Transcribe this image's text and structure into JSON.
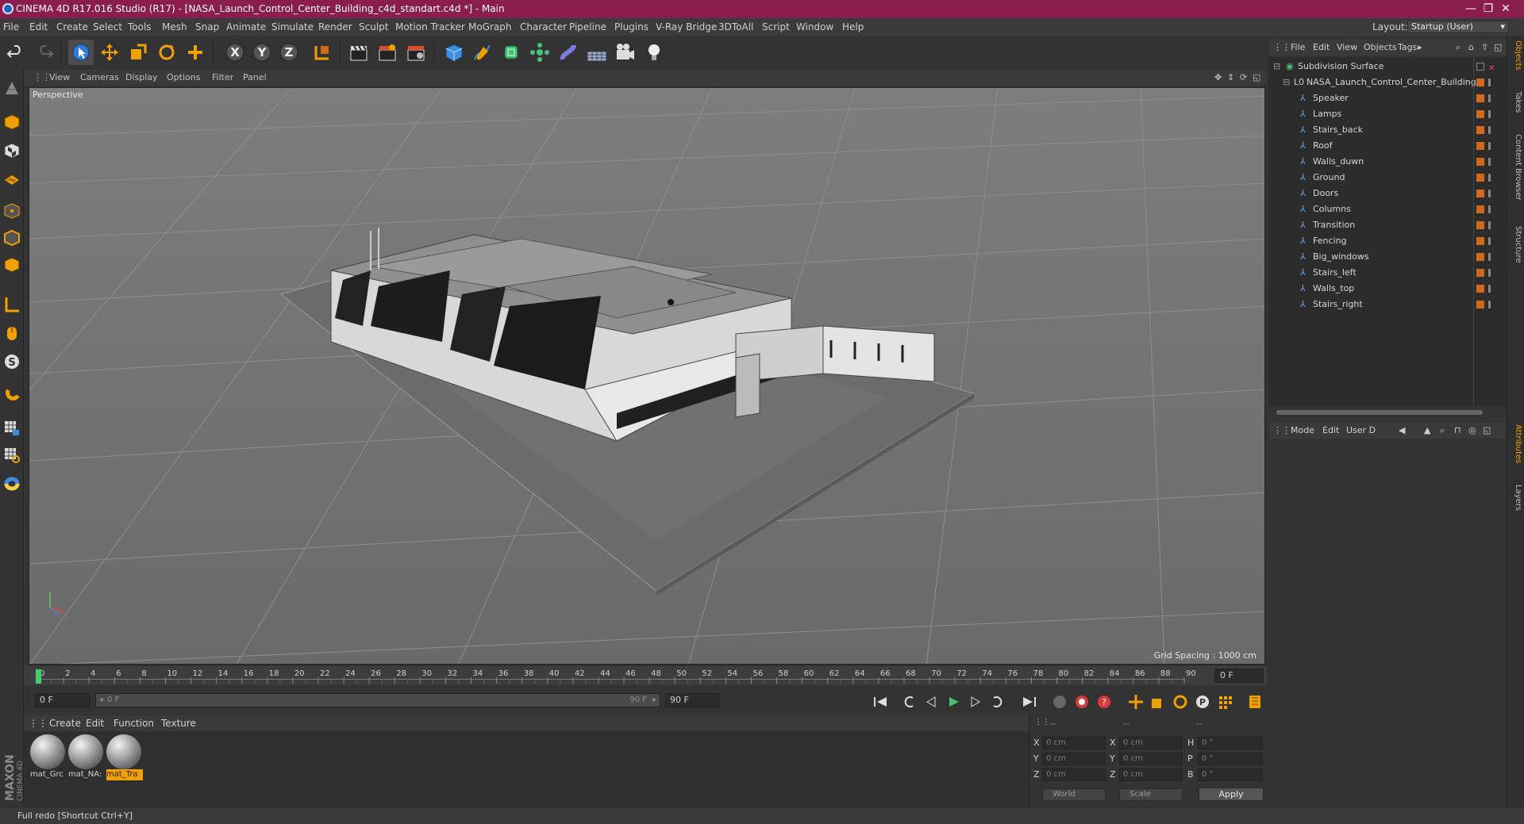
{
  "window": {
    "title": "CINEMA 4D R17.016 Studio (R17) - [NASA_Launch_Control_Center_Building_c4d_standart.c4d *] - Main",
    "minimize": "—",
    "restore": "❐",
    "close": "✕"
  },
  "menu": {
    "items": [
      "File",
      "Edit",
      "Create",
      "Select",
      "Tools",
      "Mesh",
      "Snap",
      "Animate",
      "Simulate",
      "Render",
      "Sculpt",
      "Motion Tracker",
      "MoGraph",
      "Character",
      "Pipeline",
      "Plugins",
      "V-Ray Bridge",
      "3DToAll",
      "Script",
      "Window",
      "Help"
    ],
    "layout_label": "Layout:",
    "layout_value": "Startup (User)"
  },
  "viewport": {
    "menu": [
      "View",
      "Cameras",
      "Display",
      "Options",
      "Filter",
      "Panel"
    ],
    "label": "Perspective",
    "grid_spacing": "Grid Spacing : 1000 cm"
  },
  "timeline": {
    "ticks": [
      "0",
      "2",
      "4",
      "6",
      "8",
      "10",
      "12",
      "14",
      "16",
      "18",
      "20",
      "22",
      "24",
      "26",
      "28",
      "30",
      "32",
      "34",
      "36",
      "38",
      "40",
      "42",
      "44",
      "46",
      "48",
      "50",
      "52",
      "54",
      "56",
      "58",
      "60",
      "62",
      "64",
      "66",
      "68",
      "70",
      "72",
      "74",
      "76",
      "78",
      "80",
      "82",
      "84",
      "86",
      "88",
      "90"
    ],
    "current_frame": "0 F",
    "start_field": "0 F",
    "range_start": "0 F",
    "range_end": "90 F",
    "end_field": "90 F",
    "playhead": 0
  },
  "materials": {
    "menu": [
      "Create",
      "Edit",
      "Function",
      "Texture"
    ],
    "items": [
      {
        "name": "mat_Grc",
        "selected": false
      },
      {
        "name": "mat_NA:",
        "selected": false
      },
      {
        "name": "mat_Tra",
        "selected": true
      }
    ]
  },
  "coordinates": {
    "headers": [
      "--",
      "--",
      "--"
    ],
    "rows": [
      {
        "a": "X",
        "av": "0 cm",
        "b": "X",
        "bv": "0 cm",
        "c": "H",
        "cv": "0 °"
      },
      {
        "a": "Y",
        "av": "0 cm",
        "b": "Y",
        "bv": "0 cm",
        "c": "P",
        "cv": "0 °"
      },
      {
        "a": "Z",
        "av": "0 cm",
        "b": "Z",
        "bv": "0 cm",
        "c": "B",
        "cv": "0 °"
      }
    ],
    "mode1": "World",
    "mode2": "Scale",
    "apply": "Apply"
  },
  "objects": {
    "menu": [
      "File",
      "Edit",
      "View",
      "Objects",
      "Tags"
    ],
    "tree": [
      {
        "name": "Subdivision Surface",
        "level": 0
      },
      {
        "name": "NASA_Launch_Control_Center_Building",
        "level": 1
      },
      {
        "name": "Speaker",
        "level": 2
      },
      {
        "name": "Lamps",
        "level": 2
      },
      {
        "name": "Stairs_back",
        "level": 2
      },
      {
        "name": "Roof",
        "level": 2
      },
      {
        "name": "Walls_duwn",
        "level": 2
      },
      {
        "name": "Ground",
        "level": 2
      },
      {
        "name": "Doors",
        "level": 2
      },
      {
        "name": "Columns",
        "level": 2
      },
      {
        "name": "Transition",
        "level": 2
      },
      {
        "name": "Fencing",
        "level": 2
      },
      {
        "name": "Big_windows",
        "level": 2
      },
      {
        "name": "Stairs_left",
        "level": 2
      },
      {
        "name": "Walls_top",
        "level": 2
      },
      {
        "name": "Stairs_right",
        "level": 2
      }
    ]
  },
  "attributes": {
    "menu": [
      "Mode",
      "Edit",
      "User D"
    ]
  },
  "right_tabs": [
    "Objects",
    "Takes",
    "Content Browser",
    "Structure",
    "Attributes",
    "Layers"
  ],
  "status": "Full redo [Shortcut Ctrl+Y]",
  "maxon": {
    "line1": "MAXON",
    "line2": "CINEMA 4D"
  },
  "colors": {
    "title_bar": "#8a1d4b",
    "accent": "#f0a000",
    "tag": "#d26a1e"
  }
}
